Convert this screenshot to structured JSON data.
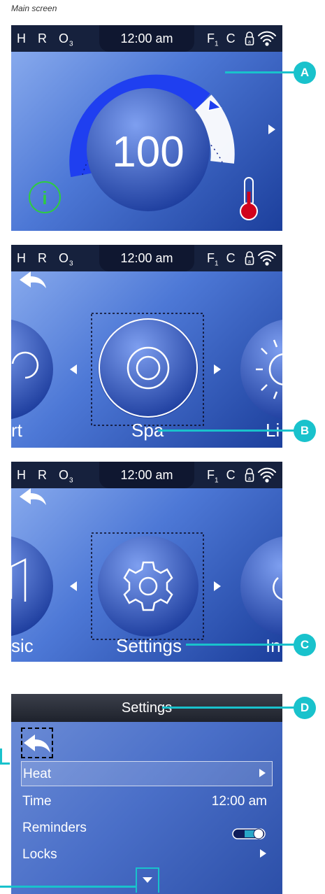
{
  "caption": "Main screen",
  "status": {
    "h": "H",
    "r": "R",
    "o3": "O",
    "o3_sub": "3",
    "time": "12:00 am",
    "f": "F",
    "f_sub": "1",
    "c": "C"
  },
  "screen1": {
    "temperature": "100",
    "info_icon": "info-icon",
    "thermometer_icon": "thermometer-icon",
    "setpoint_fraction": 0.78
  },
  "screen2": {
    "left_label": "rt",
    "center_label": "Spa",
    "right_label": "Li"
  },
  "screen3": {
    "left_label": "sic",
    "center_label": "Settings",
    "right_label": "In"
  },
  "settings": {
    "title": "Settings",
    "items": [
      {
        "label": "Heat",
        "value": ""
      },
      {
        "label": "Time",
        "value": "12:00 am"
      },
      {
        "label": "Reminders",
        "value": ""
      },
      {
        "label": "Locks",
        "value": ""
      }
    ]
  },
  "callouts": {
    "a": "A",
    "b": "B",
    "c": "C",
    "d": "D"
  },
  "colors": {
    "accent": "#19c2cc",
    "statusbar": "#16213d",
    "dial_blue": "#1f3ff0",
    "info_green": "#2ecc40",
    "thermo_red": "#d0021b"
  }
}
